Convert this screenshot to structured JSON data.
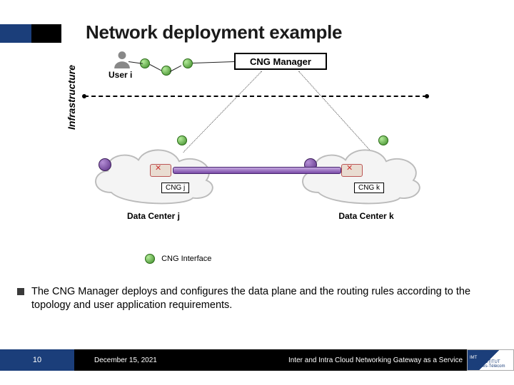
{
  "title": "Network deployment example",
  "diagram": {
    "cng_manager": "CNG Manager",
    "user": "User i",
    "infrastructure": "Infrastructure",
    "dc_j": "Data Center j",
    "dc_k": "Data Center k",
    "cng_j": "CNG j",
    "cng_k": "CNG k",
    "legend": "CNG Interface"
  },
  "bullet": "The CNG Manager deploys and configures the data plane and the routing rules according to the topology and user application requirements.",
  "footer": {
    "slide_no": "10",
    "date": "December 15, 2021",
    "topic": "Inter and Intra Cloud Networking Gateway as a Service",
    "logo_top": "IMT",
    "logo_a": "INSTITUT",
    "logo_b": "Mines-Télécom"
  }
}
